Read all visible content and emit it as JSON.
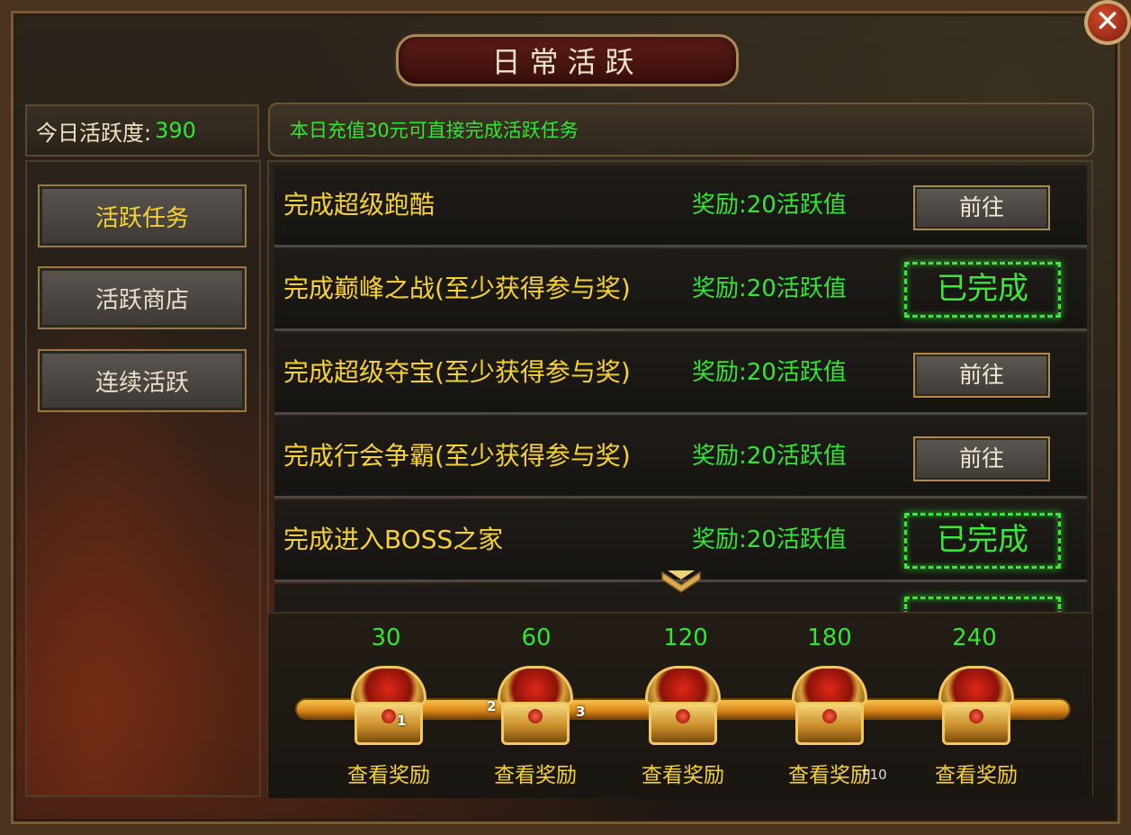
{
  "title": "日常活跃",
  "close_icon": "close-icon",
  "activity": {
    "label": "今日活跃度:",
    "value": "390"
  },
  "notice": "本日充值30元可直接完成活跃任务",
  "sidebar": {
    "items": [
      {
        "label": "活跃任务",
        "active": true
      },
      {
        "label": "活跃商店",
        "active": false
      },
      {
        "label": "连续活跃",
        "active": false
      }
    ]
  },
  "tasks": [
    {
      "name": "完成超级跑酷",
      "reward": "奖励:20活跃值",
      "action": "前往",
      "status": "go"
    },
    {
      "name": "完成巅峰之战(至少获得参与奖)",
      "reward": "奖励:20活跃值",
      "action": "已完成",
      "status": "done"
    },
    {
      "name": "完成超级夺宝(至少获得参与奖)",
      "reward": "奖励:20活跃值",
      "action": "前往",
      "status": "go"
    },
    {
      "name": "完成行会争霸(至少获得参与奖)",
      "reward": "奖励:20活跃值",
      "action": "前往",
      "status": "go"
    },
    {
      "name": "完成进入BOSS之家",
      "reward": "奖励:20活跃值",
      "action": "已完成",
      "status": "done"
    }
  ],
  "milestones": [
    {
      "threshold": "30",
      "label": "查看奖励"
    },
    {
      "threshold": "60",
      "label": "查看奖励"
    },
    {
      "threshold": "120",
      "label": "查看奖励"
    },
    {
      "threshold": "180",
      "label": "查看奖励"
    },
    {
      "threshold": "240",
      "label": "查看奖励"
    }
  ],
  "markers": {
    "m1": "1",
    "m2": "2",
    "m3": "3"
  },
  "hotkey": "F10",
  "colors": {
    "green": "#33e633",
    "gold": "#f7d230",
    "done": "#3ae83a"
  }
}
